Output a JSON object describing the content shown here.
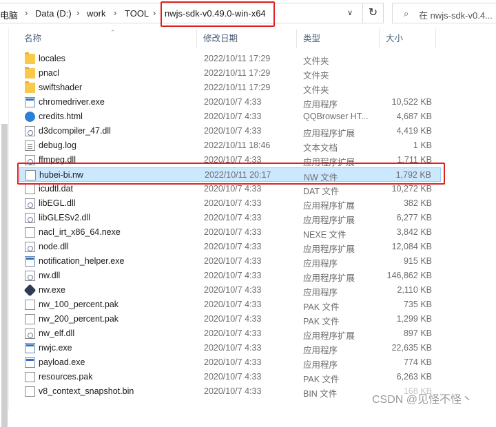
{
  "address": {
    "crumbs": [
      "电脑",
      "Data (D:)",
      "work",
      "TOOL",
      "nwjs-sdk-v0.49.0-win-x64"
    ],
    "separator": ">",
    "search_placeholder": "在 nwjs-sdk-v0.4..."
  },
  "columns": {
    "name": "名称",
    "date": "修改日期",
    "type": "类型",
    "size": "大小"
  },
  "files": [
    {
      "name": "locales",
      "date": "2022/10/11 17:29",
      "type": "文件夹",
      "size": "",
      "icon": "folder"
    },
    {
      "name": "pnacl",
      "date": "2022/10/11 17:29",
      "type": "文件夹",
      "size": "",
      "icon": "folder"
    },
    {
      "name": "swiftshader",
      "date": "2022/10/11 17:29",
      "type": "文件夹",
      "size": "",
      "icon": "folder"
    },
    {
      "name": "chromedriver.exe",
      "date": "2020/10/7 4:33",
      "type": "应用程序",
      "size": "10,522 KB",
      "icon": "exe"
    },
    {
      "name": "credits.html",
      "date": "2020/10/7 4:33",
      "type": "QQBrowser HT...",
      "size": "4,687 KB",
      "icon": "html"
    },
    {
      "name": "d3dcompiler_47.dll",
      "date": "2020/10/7 4:33",
      "type": "应用程序扩展",
      "size": "4,419 KB",
      "icon": "dll"
    },
    {
      "name": "debug.log",
      "date": "2022/10/11 18:46",
      "type": "文本文档",
      "size": "1 KB",
      "icon": "log"
    },
    {
      "name": "ffmpeg.dll",
      "date": "2020/10/7 4:33",
      "type": "应用程序扩展",
      "size": "1,711 KB",
      "icon": "dll"
    },
    {
      "name": "hubei-bi.nw",
      "date": "2022/10/11 20:17",
      "type": "NW 文件",
      "size": "1,792 KB",
      "icon": "doc",
      "selected": true
    },
    {
      "name": "icudtl.dat",
      "date": "2020/10/7 4:33",
      "type": "DAT 文件",
      "size": "10,272 KB",
      "icon": "doc"
    },
    {
      "name": "libEGL.dll",
      "date": "2020/10/7 4:33",
      "type": "应用程序扩展",
      "size": "382 KB",
      "icon": "dll"
    },
    {
      "name": "libGLESv2.dll",
      "date": "2020/10/7 4:33",
      "type": "应用程序扩展",
      "size": "6,277 KB",
      "icon": "dll"
    },
    {
      "name": "nacl_irt_x86_64.nexe",
      "date": "2020/10/7 4:33",
      "type": "NEXE 文件",
      "size": "3,842 KB",
      "icon": "doc"
    },
    {
      "name": "node.dll",
      "date": "2020/10/7 4:33",
      "type": "应用程序扩展",
      "size": "12,084 KB",
      "icon": "dll"
    },
    {
      "name": "notification_helper.exe",
      "date": "2020/10/7 4:33",
      "type": "应用程序",
      "size": "915 KB",
      "icon": "exe"
    },
    {
      "name": "nw.dll",
      "date": "2020/10/7 4:33",
      "type": "应用程序扩展",
      "size": "146,862 KB",
      "icon": "dll"
    },
    {
      "name": "nw.exe",
      "date": "2020/10/7 4:33",
      "type": "应用程序",
      "size": "2,110 KB",
      "icon": "nw"
    },
    {
      "name": "nw_100_percent.pak",
      "date": "2020/10/7 4:33",
      "type": "PAK 文件",
      "size": "735 KB",
      "icon": "doc"
    },
    {
      "name": "nw_200_percent.pak",
      "date": "2020/10/7 4:33",
      "type": "PAK 文件",
      "size": "1,299 KB",
      "icon": "doc"
    },
    {
      "name": "nw_elf.dll",
      "date": "2020/10/7 4:33",
      "type": "应用程序扩展",
      "size": "897 KB",
      "icon": "dll"
    },
    {
      "name": "nwjc.exe",
      "date": "2020/10/7 4:33",
      "type": "应用程序",
      "size": "22,635 KB",
      "icon": "exe"
    },
    {
      "name": "payload.exe",
      "date": "2020/10/7 4:33",
      "type": "应用程序",
      "size": "774 KB",
      "icon": "exe"
    },
    {
      "name": "resources.pak",
      "date": "2020/10/7 4:33",
      "type": "PAK 文件",
      "size": "6,263 KB",
      "icon": "doc"
    },
    {
      "name": "v8_context_snapshot.bin",
      "date": "2020/10/7 4:33",
      "type": "BIN 文件",
      "size": "168 KB",
      "icon": "doc"
    }
  ],
  "watermark": "CSDN @见怪不怪丶",
  "colors": {
    "selection": "#cce8ff",
    "highlight_box": "#e02020",
    "folder": "#f8c94a"
  }
}
